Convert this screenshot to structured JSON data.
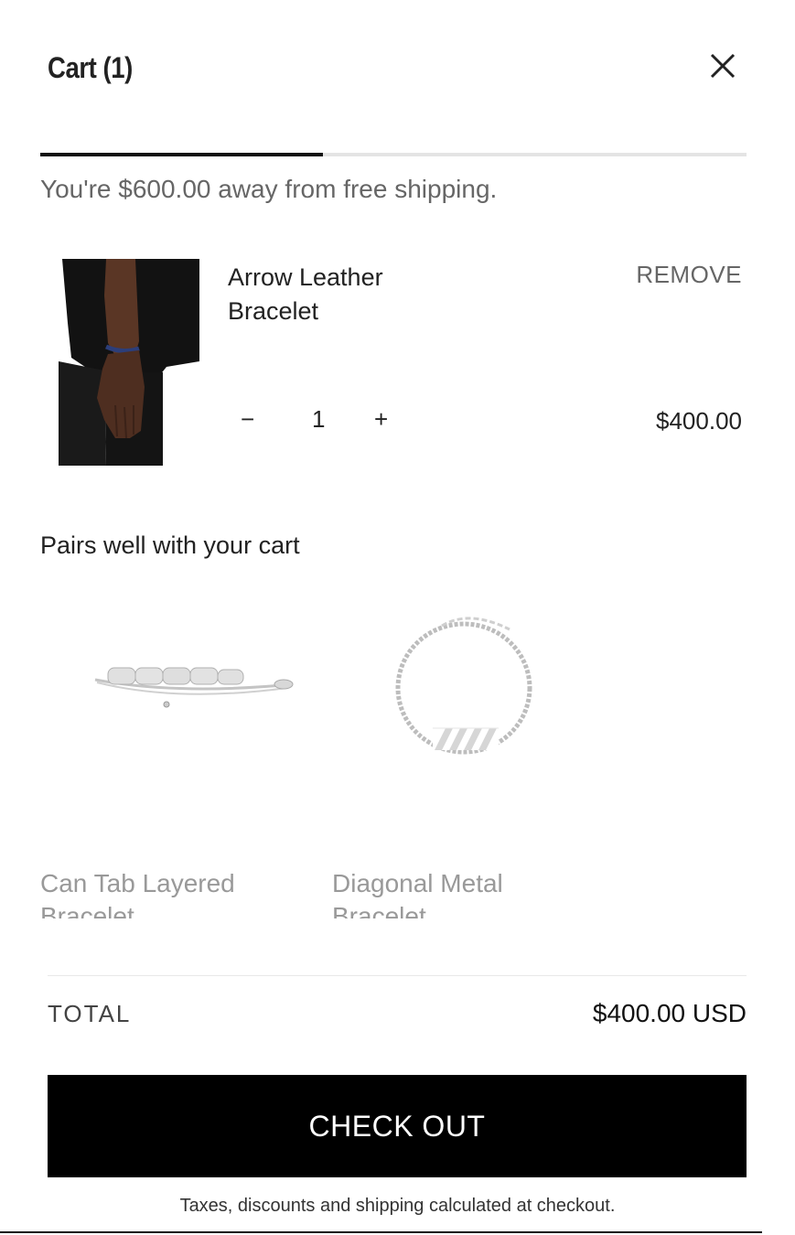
{
  "header": {
    "title": "Cart (1)",
    "close_icon": "close-icon"
  },
  "shipping": {
    "message": "You're $600.00 away from free shipping.",
    "progress": 0.4
  },
  "line_item": {
    "name": "Arrow Leather Bracelet",
    "remove_label": "REMOVE",
    "quantity": "1",
    "minus_label": "−",
    "plus_label": "+",
    "price": "$400.00"
  },
  "recommendations": {
    "heading": "Pairs well with your cart",
    "items": [
      {
        "name": "Can Tab Layered Bracelet"
      },
      {
        "name": "Diagonal Metal Bracelet"
      }
    ]
  },
  "footer": {
    "total_label": "TOTAL",
    "total_value": "$400.00 USD",
    "checkout_label": "CHECK OUT",
    "disclaimer": "Taxes, discounts and shipping calculated at checkout."
  }
}
